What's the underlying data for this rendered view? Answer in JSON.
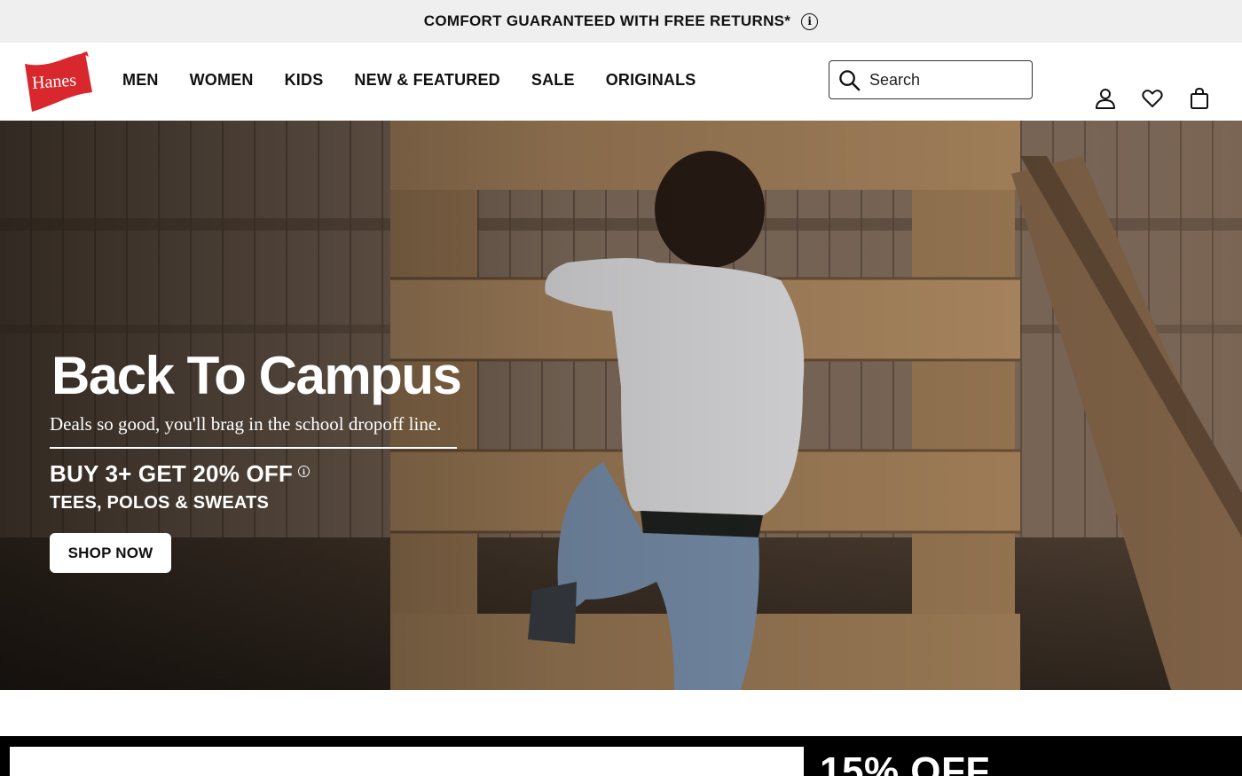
{
  "announcement": {
    "text": "COMFORT GUARANTEED WITH FREE RETURNS*",
    "icon": "info-icon"
  },
  "brand": {
    "logo_text": "Hanes",
    "logo_color": "#d8282e"
  },
  "nav": {
    "items": [
      {
        "label": "MEN"
      },
      {
        "label": "WOMEN"
      },
      {
        "label": "KIDS"
      },
      {
        "label": "NEW & FEATURED"
      },
      {
        "label": "SALE"
      },
      {
        "label": "ORIGINALS"
      }
    ]
  },
  "search": {
    "placeholder": "Search",
    "icon": "search-icon"
  },
  "utility": {
    "icons": [
      "account-icon",
      "heart-icon",
      "bag-icon"
    ]
  },
  "hero": {
    "title": "Back To Campus",
    "subtitle": "Deals so good, you'll brag in the school dropoff line.",
    "offer": "BUY 3+ GET 20% OFF",
    "category": "TEES, POLOS & SWEATS",
    "cta": "SHOP NOW",
    "image": "child climbing wooden playset in backyard"
  },
  "promo": {
    "text": "15% OFF"
  }
}
